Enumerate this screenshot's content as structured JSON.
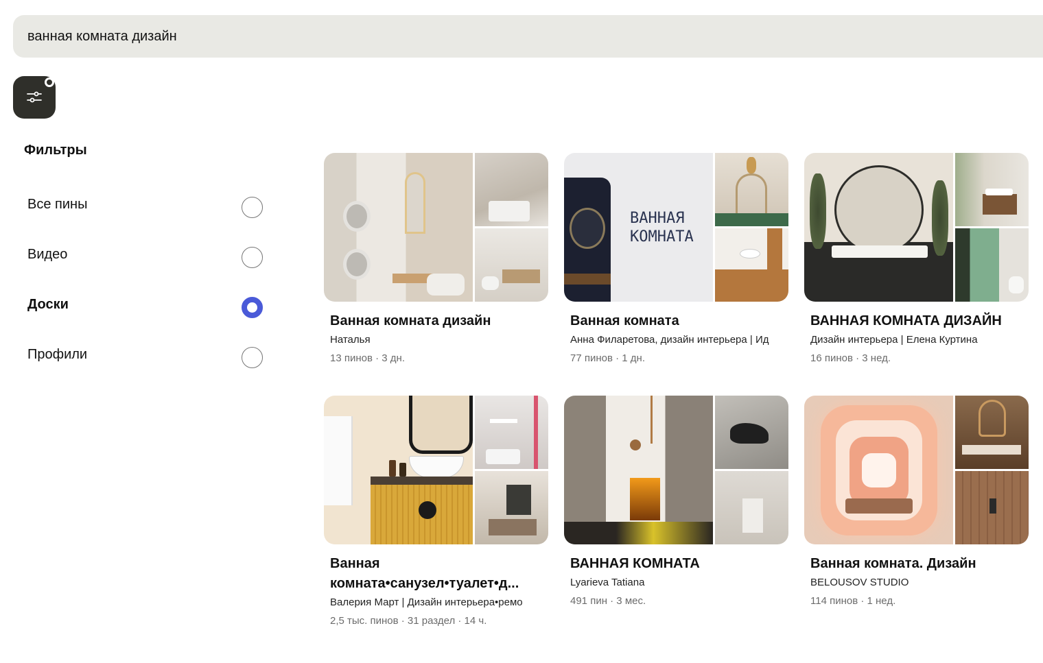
{
  "search": {
    "query": "ванная комната дизайн"
  },
  "filters": {
    "title": "Фильтры",
    "options": [
      {
        "label": "Все пины",
        "selected": false
      },
      {
        "label": "Видео",
        "selected": false
      },
      {
        "label": "Доски",
        "selected": true
      },
      {
        "label": "Профили",
        "selected": false
      }
    ]
  },
  "boards": [
    {
      "title": "Ванная комната дизайн",
      "owner": "Наталья",
      "meta": "13 пинов · 3 дн."
    },
    {
      "title": "Ванная комната",
      "owner": "Анна Филаретова, дизайн интерьера | Ид",
      "meta": "77 пинов · 1 дн.",
      "cover_text": "ВАННАЯ КОМНАТА"
    },
    {
      "title": "ВАННАЯ КОМНАТА ДИЗАЙН",
      "owner": "Дизайн интерьера | Елена Куртина",
      "meta": "16 пинов · 3 нед."
    },
    {
      "title": "Ванная комната•санузел•туалет•д...",
      "owner": "Валерия Март | Дизайн интерьера•ремо",
      "meta": "2,5 тыс. пинов · 31 раздел · 14 ч."
    },
    {
      "title": "ВАННАЯ КОМНАТА",
      "owner": "Lyarieva Tatiana",
      "meta": "491 пин · 3 мес."
    },
    {
      "title": "Ванная комната. Дизайн",
      "owner": "BELOUSOV STUDIO",
      "meta": "114 пинов · 1 нед."
    }
  ],
  "colors": {
    "radio_selected": "#4a5ad8",
    "search_bg": "#e9e9e4",
    "filter_button_bg": "#2f2f2a"
  }
}
